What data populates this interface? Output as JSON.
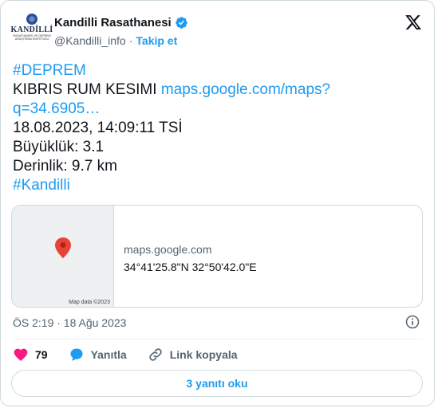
{
  "account": {
    "name": "Kandilli Rasathanesi",
    "handle": "@Kandilli_info",
    "separator": "·",
    "follow_label": "Takip et",
    "avatar_brand": "KANDİLLİ",
    "avatar_subtext": "RASATHANESİ VE DEPREM ARAŞTIRMA ENSTİTÜSÜ"
  },
  "tweet": {
    "lines": [
      {
        "parts": [
          {
            "text": "#DEPREM",
            "link": true
          }
        ]
      },
      {
        "parts": [
          {
            "text": "KIBRIS RUM KESIMI ",
            "link": false
          },
          {
            "text": "maps.google.com/maps?",
            "link": true
          }
        ]
      },
      {
        "parts": [
          {
            "text": "q=34.6905…",
            "link": true
          }
        ]
      },
      {
        "parts": [
          {
            "text": "18.08.2023, 14:09:11 TSİ",
            "link": false
          }
        ]
      },
      {
        "parts": [
          {
            "text": "Büyüklük: 3.1",
            "link": false
          }
        ]
      },
      {
        "parts": [
          {
            "text": "Derinlik: 9.7 km",
            "link": false
          }
        ]
      },
      {
        "parts": [
          {
            "text": "#Kandilli",
            "link": true
          }
        ]
      }
    ]
  },
  "map_card": {
    "domain": "maps.google.com",
    "coordinates": "34°41'25.8\"N 32°50'42.0\"E",
    "credit": "Map data ©2023"
  },
  "meta": {
    "timestamp": "ÖS 2:19 · 18 Ağu 2023"
  },
  "actions": {
    "like_count": "79",
    "reply_label": "Yanıtla",
    "copy_link_label": "Link kopyala"
  },
  "read_replies_label": "3 yanıtı oku",
  "colors": {
    "accent": "#1d9bf0",
    "like": "#f91880",
    "text": "#0f1419",
    "muted": "#536471"
  }
}
